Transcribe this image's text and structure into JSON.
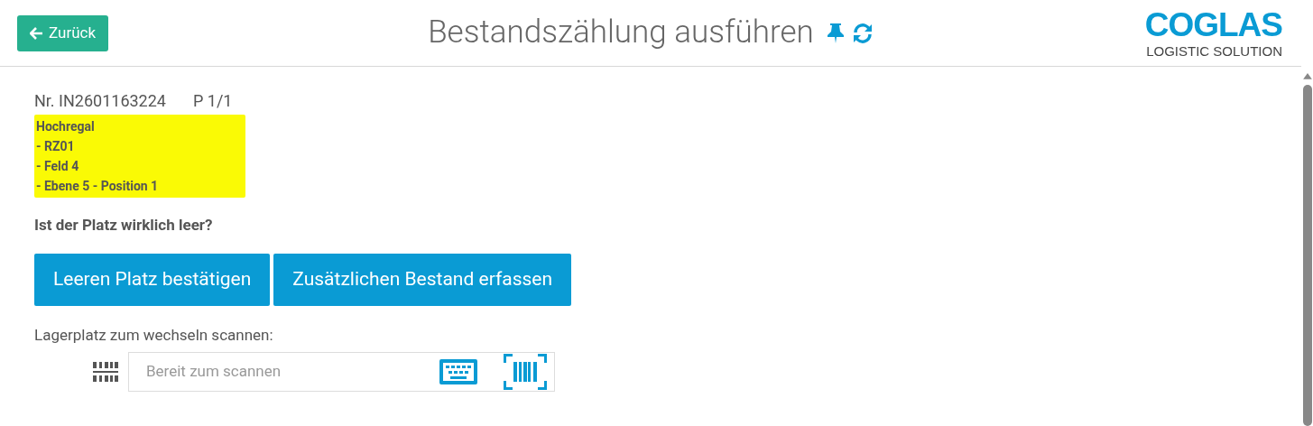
{
  "header": {
    "back_button": "Zurück",
    "title": "Bestandszählung ausführen",
    "logo": {
      "name": "COGLAS",
      "tagline": "LOGISTIC SOLUTION"
    }
  },
  "document": {
    "number": "Nr. IN2601163224",
    "page": "P 1/1"
  },
  "location": {
    "color": "#fafa05",
    "lines": [
      "Hochregal",
      "- RZ01",
      "- Feld 4",
      "- Ebene 5 - Position 1"
    ]
  },
  "question": "Ist der Platz wirklich leer?",
  "actions": [
    "Leeren Platz bestätigen",
    "Zusätzlichen Bestand erfassen"
  ],
  "scan": {
    "label": "Lagerplatz zum wechseln scannen:",
    "placeholder": "Bereit zum scannen"
  }
}
